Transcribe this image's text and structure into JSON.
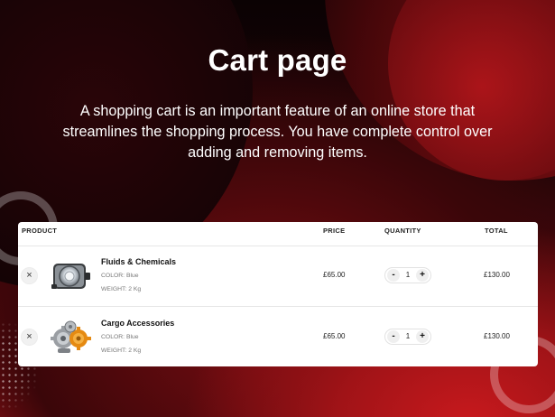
{
  "hero": {
    "title": "Cart page",
    "description": "A shopping cart is an important feature of an online store that streamlines the shopping process. You have complete control over adding and removing items."
  },
  "cart": {
    "columns": {
      "product": "PRODUCT",
      "price": "PRICE",
      "quantity": "QUANTITY",
      "total": "TOTAL"
    },
    "items": [
      {
        "name": "Fluids & Chemicals",
        "color": "COLOR: Blue",
        "weight": "WEIGHT: 2 Kg",
        "price": "£65.00",
        "quantity": "1",
        "total": "£130.00",
        "remove": "×",
        "minus": "-",
        "plus": "+",
        "thumb_icon": "headlight-icon"
      },
      {
        "name": "Cargo Accessories",
        "color": "COLOR: Blue",
        "weight": "WEIGHT: 2 Kg",
        "price": "£65.00",
        "quantity": "1",
        "total": "£130.00",
        "remove": "×",
        "minus": "-",
        "plus": "+",
        "thumb_icon": "gears-icon"
      }
    ]
  },
  "colors": {
    "accent_red": "#c8191d",
    "dark_bg": "#120406"
  }
}
